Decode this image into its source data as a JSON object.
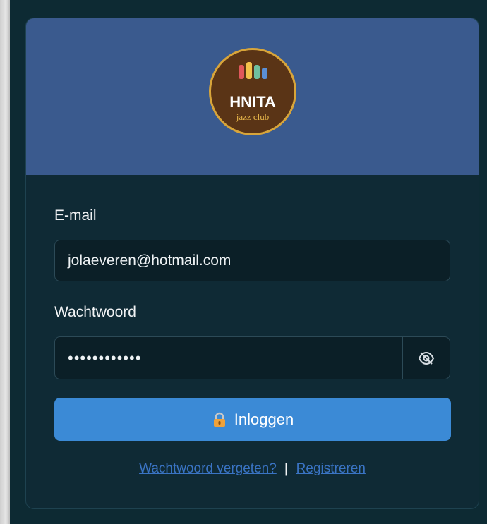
{
  "brand": {
    "logo_text": "HNITA",
    "logo_sub": "jazz club",
    "colors": {
      "header": "#3a5a8e",
      "card": "#0f2a35",
      "button": "#3b8ad6",
      "link": "#3a74c4",
      "logo_bg": "#5a3416",
      "logo_ring": "#d8a53a"
    }
  },
  "form": {
    "email_label": "E-mail",
    "email_value": "jolaeveren@hotmail.com",
    "password_label": "Wachtwoord",
    "password_value": "••••••••••••",
    "password_toggle_icon": "eye-slash-icon",
    "login_icon": "lock-icon",
    "login_label": "Inloggen"
  },
  "links": {
    "forgot": "Wachtwoord vergeten?",
    "separator": "|",
    "register": "Registreren"
  }
}
